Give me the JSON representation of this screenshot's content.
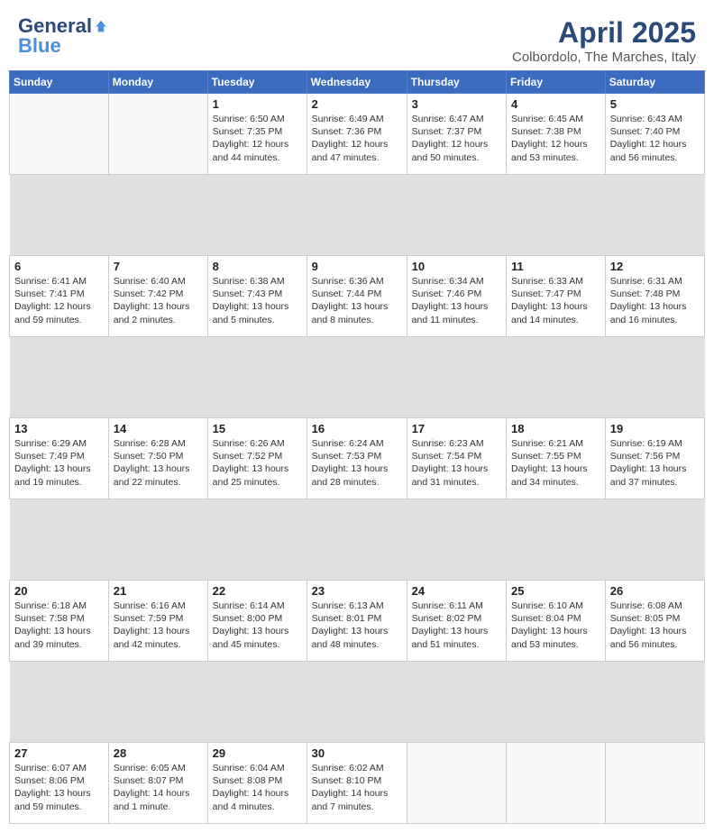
{
  "header": {
    "logo_general": "General",
    "logo_blue": "Blue",
    "title": "April 2025",
    "location": "Colbordolo, The Marches, Italy"
  },
  "weekdays": [
    "Sunday",
    "Monday",
    "Tuesday",
    "Wednesday",
    "Thursday",
    "Friday",
    "Saturday"
  ],
  "weeks": [
    [
      {
        "day": "",
        "info": ""
      },
      {
        "day": "",
        "info": ""
      },
      {
        "day": "1",
        "info": "Sunrise: 6:50 AM\nSunset: 7:35 PM\nDaylight: 12 hours and 44 minutes."
      },
      {
        "day": "2",
        "info": "Sunrise: 6:49 AM\nSunset: 7:36 PM\nDaylight: 12 hours and 47 minutes."
      },
      {
        "day": "3",
        "info": "Sunrise: 6:47 AM\nSunset: 7:37 PM\nDaylight: 12 hours and 50 minutes."
      },
      {
        "day": "4",
        "info": "Sunrise: 6:45 AM\nSunset: 7:38 PM\nDaylight: 12 hours and 53 minutes."
      },
      {
        "day": "5",
        "info": "Sunrise: 6:43 AM\nSunset: 7:40 PM\nDaylight: 12 hours and 56 minutes."
      }
    ],
    [
      {
        "day": "6",
        "info": "Sunrise: 6:41 AM\nSunset: 7:41 PM\nDaylight: 12 hours and 59 minutes."
      },
      {
        "day": "7",
        "info": "Sunrise: 6:40 AM\nSunset: 7:42 PM\nDaylight: 13 hours and 2 minutes."
      },
      {
        "day": "8",
        "info": "Sunrise: 6:38 AM\nSunset: 7:43 PM\nDaylight: 13 hours and 5 minutes."
      },
      {
        "day": "9",
        "info": "Sunrise: 6:36 AM\nSunset: 7:44 PM\nDaylight: 13 hours and 8 minutes."
      },
      {
        "day": "10",
        "info": "Sunrise: 6:34 AM\nSunset: 7:46 PM\nDaylight: 13 hours and 11 minutes."
      },
      {
        "day": "11",
        "info": "Sunrise: 6:33 AM\nSunset: 7:47 PM\nDaylight: 13 hours and 14 minutes."
      },
      {
        "day": "12",
        "info": "Sunrise: 6:31 AM\nSunset: 7:48 PM\nDaylight: 13 hours and 16 minutes."
      }
    ],
    [
      {
        "day": "13",
        "info": "Sunrise: 6:29 AM\nSunset: 7:49 PM\nDaylight: 13 hours and 19 minutes."
      },
      {
        "day": "14",
        "info": "Sunrise: 6:28 AM\nSunset: 7:50 PM\nDaylight: 13 hours and 22 minutes."
      },
      {
        "day": "15",
        "info": "Sunrise: 6:26 AM\nSunset: 7:52 PM\nDaylight: 13 hours and 25 minutes."
      },
      {
        "day": "16",
        "info": "Sunrise: 6:24 AM\nSunset: 7:53 PM\nDaylight: 13 hours and 28 minutes."
      },
      {
        "day": "17",
        "info": "Sunrise: 6:23 AM\nSunset: 7:54 PM\nDaylight: 13 hours and 31 minutes."
      },
      {
        "day": "18",
        "info": "Sunrise: 6:21 AM\nSunset: 7:55 PM\nDaylight: 13 hours and 34 minutes."
      },
      {
        "day": "19",
        "info": "Sunrise: 6:19 AM\nSunset: 7:56 PM\nDaylight: 13 hours and 37 minutes."
      }
    ],
    [
      {
        "day": "20",
        "info": "Sunrise: 6:18 AM\nSunset: 7:58 PM\nDaylight: 13 hours and 39 minutes."
      },
      {
        "day": "21",
        "info": "Sunrise: 6:16 AM\nSunset: 7:59 PM\nDaylight: 13 hours and 42 minutes."
      },
      {
        "day": "22",
        "info": "Sunrise: 6:14 AM\nSunset: 8:00 PM\nDaylight: 13 hours and 45 minutes."
      },
      {
        "day": "23",
        "info": "Sunrise: 6:13 AM\nSunset: 8:01 PM\nDaylight: 13 hours and 48 minutes."
      },
      {
        "day": "24",
        "info": "Sunrise: 6:11 AM\nSunset: 8:02 PM\nDaylight: 13 hours and 51 minutes."
      },
      {
        "day": "25",
        "info": "Sunrise: 6:10 AM\nSunset: 8:04 PM\nDaylight: 13 hours and 53 minutes."
      },
      {
        "day": "26",
        "info": "Sunrise: 6:08 AM\nSunset: 8:05 PM\nDaylight: 13 hours and 56 minutes."
      }
    ],
    [
      {
        "day": "27",
        "info": "Sunrise: 6:07 AM\nSunset: 8:06 PM\nDaylight: 13 hours and 59 minutes."
      },
      {
        "day": "28",
        "info": "Sunrise: 6:05 AM\nSunset: 8:07 PM\nDaylight: 14 hours and 1 minute."
      },
      {
        "day": "29",
        "info": "Sunrise: 6:04 AM\nSunset: 8:08 PM\nDaylight: 14 hours and 4 minutes."
      },
      {
        "day": "30",
        "info": "Sunrise: 6:02 AM\nSunset: 8:10 PM\nDaylight: 14 hours and 7 minutes."
      },
      {
        "day": "",
        "info": ""
      },
      {
        "day": "",
        "info": ""
      },
      {
        "day": "",
        "info": ""
      }
    ]
  ]
}
